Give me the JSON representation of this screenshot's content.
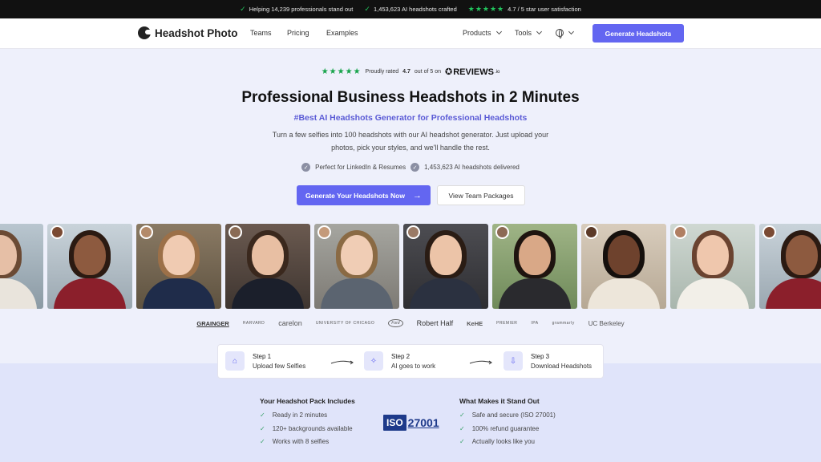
{
  "topbar": {
    "items": [
      "Helping 14,239 professionals stand out",
      "1,453,623 AI headshots crafted",
      "4.7 / 5 star user satisfaction"
    ]
  },
  "nav": {
    "brand": "Headshot Photo",
    "links": [
      "Teams",
      "Pricing",
      "Examples"
    ],
    "products_label": "Products",
    "tools_label": "Tools",
    "cta_label": "Generate Headshots"
  },
  "rating": {
    "prefix": "Proudly rated",
    "score": "4.7",
    "suffix": "out of 5 on",
    "platform": "REVIEWS",
    "platform_suffix": ".io"
  },
  "hero": {
    "title": "Professional Business Headshots in 2 Minutes",
    "subtitle": "#Best AI Headshots Generator for Professional Headshots",
    "description": "Turn a few selfies into 100 headshots with our AI headshot generator. Just upload your photos, pick your styles, and we'll handle the rest.",
    "features": [
      "Perfect for LinkedIn & Resumes",
      "1,453,623 AI headshots delivered"
    ],
    "primary_cta": "Generate Your Headshots Now",
    "secondary_cta": "View Team Packages"
  },
  "logos": [
    "GRAINGER",
    "HARVARD",
    "carelon",
    "UNIVERSITY OF CHICAGO",
    "Ford",
    "Robert Half",
    "KeHE",
    "PREMIER",
    "IPA",
    "grammarly",
    "UC Berkeley"
  ],
  "steps": [
    {
      "title": "Step 1",
      "subtitle": "Upload few Selfies"
    },
    {
      "title": "Step 2",
      "subtitle": "AI goes to work"
    },
    {
      "title": "Step 3",
      "subtitle": "Download Headshots"
    }
  ],
  "pack": {
    "title": "Your Headshot Pack Includes",
    "items": [
      "Ready in 2 minutes",
      "120+ backgrounds available",
      "Works with 8 selfies"
    ]
  },
  "standout": {
    "title": "What Makes it Stand Out",
    "items": [
      "Safe and secure (ISO 27001)",
      "100% refund guarantee",
      "Actually looks like you"
    ]
  },
  "iso": {
    "label": "ISO",
    "number": "27001"
  },
  "colors": {
    "accent": "#6366f1",
    "subtitle": "#5b5bd6",
    "check": "#22c55e"
  }
}
